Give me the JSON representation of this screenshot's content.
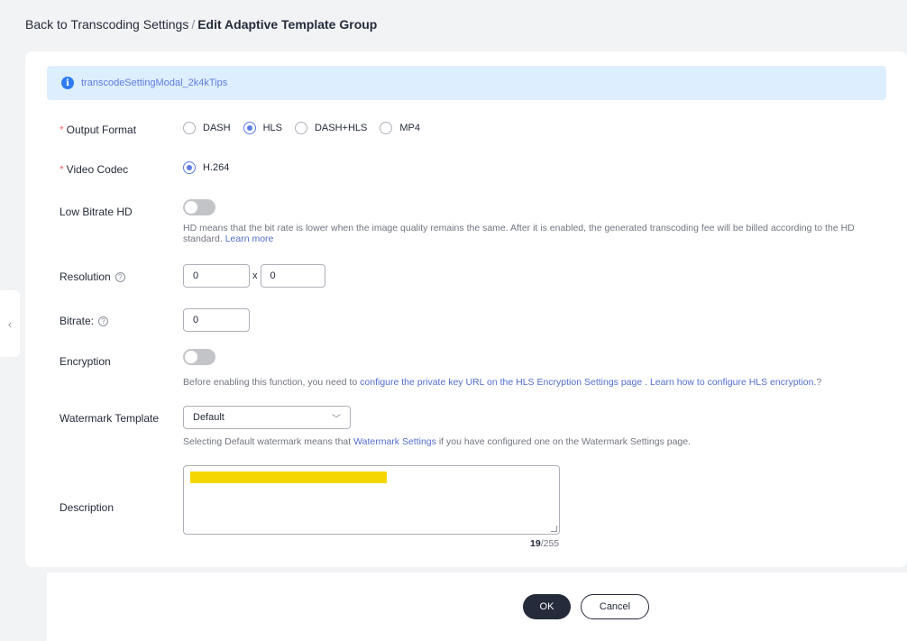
{
  "header": {
    "back_label": "Back to Transcoding Settings",
    "separator": "/",
    "title": "Edit Adaptive Template Group"
  },
  "tip": {
    "text": "transcodeSettingModal_2k4kTips"
  },
  "output_format": {
    "label": "Output Format",
    "options": [
      "DASH",
      "HLS",
      "DASH+HLS",
      "MP4"
    ],
    "selected": "HLS"
  },
  "video_codec": {
    "label": "Video Codec",
    "options": [
      "H.264"
    ],
    "selected": "H.264"
  },
  "low_bitrate_hd": {
    "label": "Low Bitrate HD",
    "enabled": false,
    "help": "HD means that the bit rate is lower when the image quality remains the same. After it is enabled, the generated transcoding fee will be billed according to the HD standard.",
    "learn_more": "Learn more"
  },
  "resolution": {
    "label": "Resolution",
    "width": "0",
    "separator": "x",
    "height": "0"
  },
  "bitrate": {
    "label": "Bitrate:",
    "value": "0"
  },
  "encryption": {
    "label": "Encryption",
    "enabled": false,
    "help_prefix": "Before enabling this function, you need to",
    "link_configure": "configure the private key URL on the HLS Encryption Settings page",
    "link_learn": ". Learn how to configure HLS encryption.",
    "suffix": "?"
  },
  "watermark": {
    "label": "Watermark Template",
    "selected": "Default",
    "help_prefix": "Selecting Default watermark means that",
    "link": "Watermark Settings",
    "help_suffix": "if you have configured one on the Watermark Settings page."
  },
  "description": {
    "label": "Description",
    "count": "19",
    "max": "/255"
  },
  "footer": {
    "ok_label": "OK",
    "cancel_label": "Cancel"
  },
  "colors": {
    "accent": "#5e7ce0",
    "required": "#f66f6a",
    "tip_bg": "#ddeefe",
    "primary_button": "#252b3a",
    "redaction": "#f4d600"
  },
  "icons": {
    "tip": "info-icon",
    "help": "question-circle-icon",
    "collapse": "chevron-left-icon",
    "dropdown": "chevron-down-icon"
  }
}
